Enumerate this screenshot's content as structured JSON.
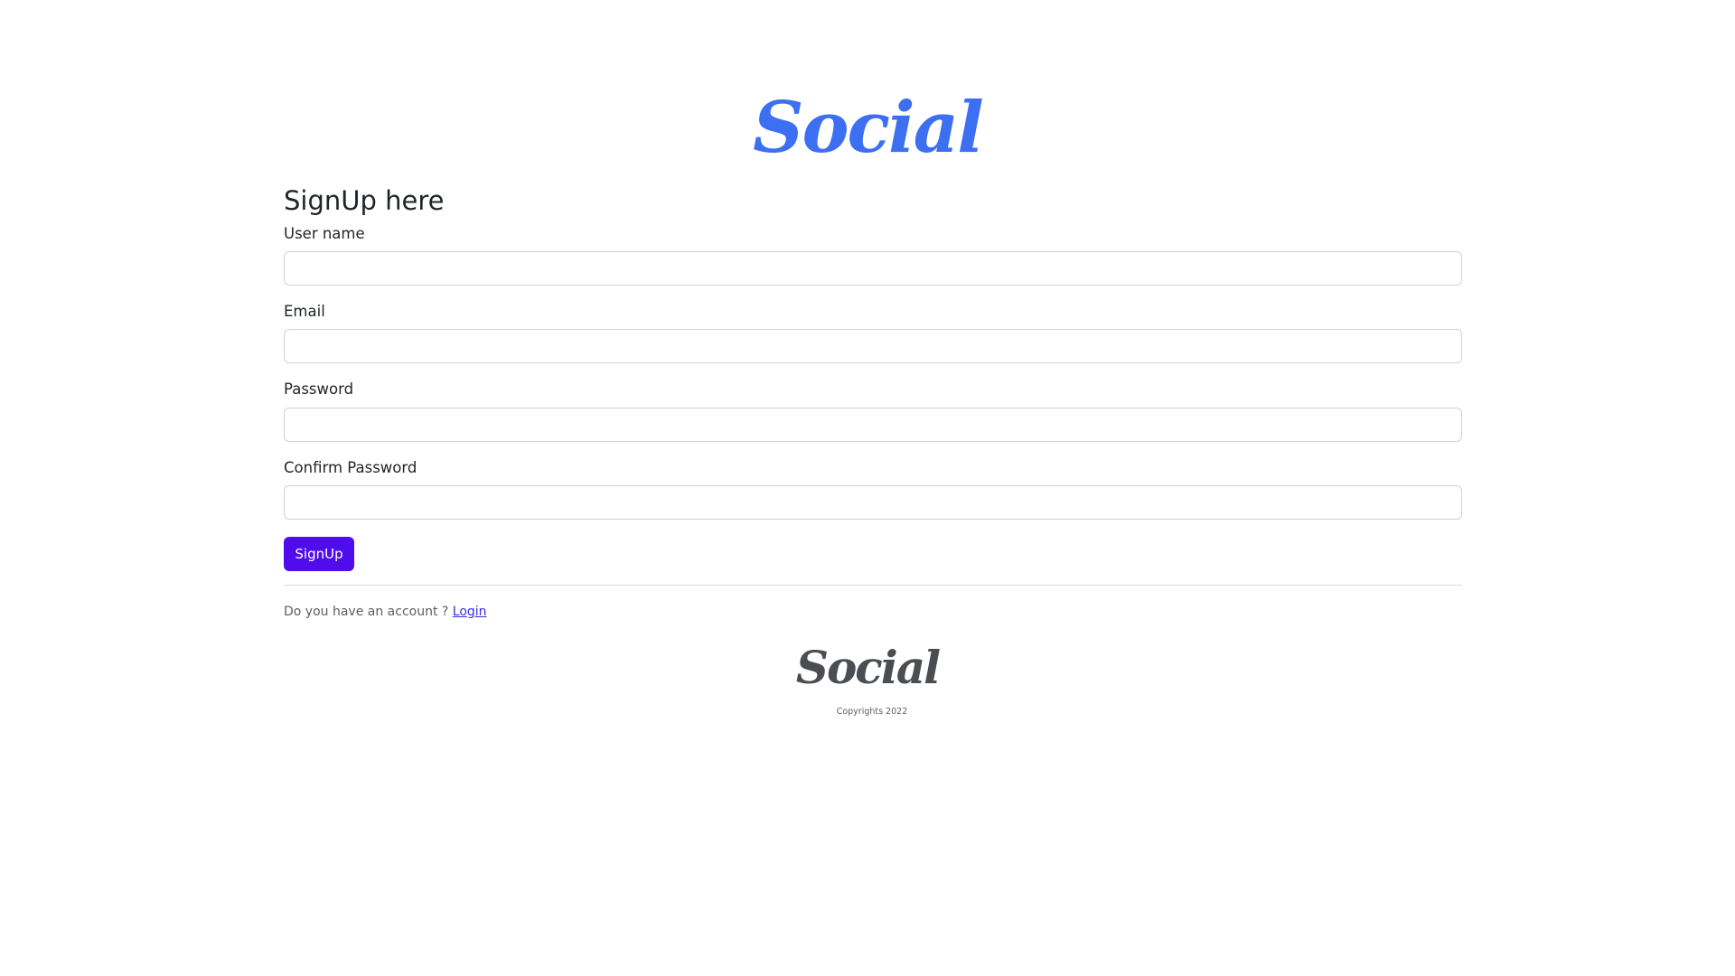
{
  "brand": {
    "name": "Social"
  },
  "form": {
    "title": "SignUp here",
    "fields": [
      {
        "label": "User name",
        "value": ""
      },
      {
        "label": "Email",
        "value": ""
      },
      {
        "label": "Password",
        "value": ""
      },
      {
        "label": "Confirm Password",
        "value": ""
      }
    ],
    "submit_label": "SignUp"
  },
  "account": {
    "prompt": "Do you have an account ? ",
    "login_label": "Login"
  },
  "footer": {
    "brand": "Social",
    "copyright": "Copyrights 2022"
  },
  "colors": {
    "brand_primary": "#3d6ff2",
    "button": "#4f0ded",
    "link": "#3a2be8",
    "footer_brand": "#4a4d52"
  }
}
